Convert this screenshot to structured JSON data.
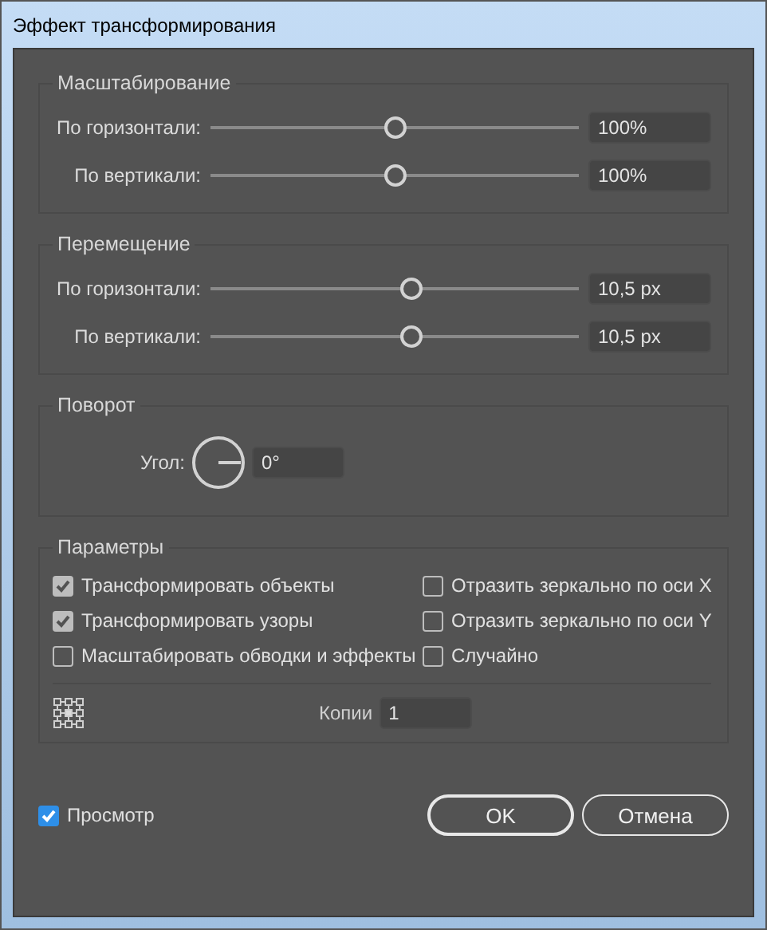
{
  "window": {
    "title": "Эффект трансформирования"
  },
  "sections": [
    {
      "kind": "sliders",
      "title": "Масштабирование",
      "rows": [
        {
          "label": "По горизонтали:",
          "level": 0.5,
          "value": "100%"
        },
        {
          "label": "По вертикали:",
          "level": 0.5,
          "value": "100%"
        }
      ]
    },
    {
      "kind": "sliders",
      "title": "Перемещение",
      "rows": [
        {
          "label": "По горизонтали:",
          "level": 0.545,
          "value": "10,5 px"
        },
        {
          "label": "По вертикали:",
          "level": 0.545,
          "value": "10,5 px"
        }
      ]
    },
    {
      "kind": "angle",
      "title": "Поворот",
      "label": "Угол:",
      "value": "0°"
    },
    {
      "kind": "options",
      "title": "Параметры",
      "checkboxes": [
        {
          "label": "Трансформировать объекты",
          "checked": true
        },
        {
          "label": "Отразить зеркально по оси X",
          "checked": false
        },
        {
          "label": "Трансформировать узоры",
          "checked": true
        },
        {
          "label": "Отразить зеркально по оси Y",
          "checked": false
        },
        {
          "label": "Масштабировать обводки и эффекты",
          "checked": false
        },
        {
          "label": "Случайно",
          "checked": false
        }
      ],
      "copies": {
        "label": "Копии",
        "value": "1"
      }
    }
  ],
  "preview": {
    "label": "Просмотр",
    "checked": true
  },
  "buttons": [
    {
      "label": "OK"
    },
    {
      "label": "Отмена"
    }
  ]
}
